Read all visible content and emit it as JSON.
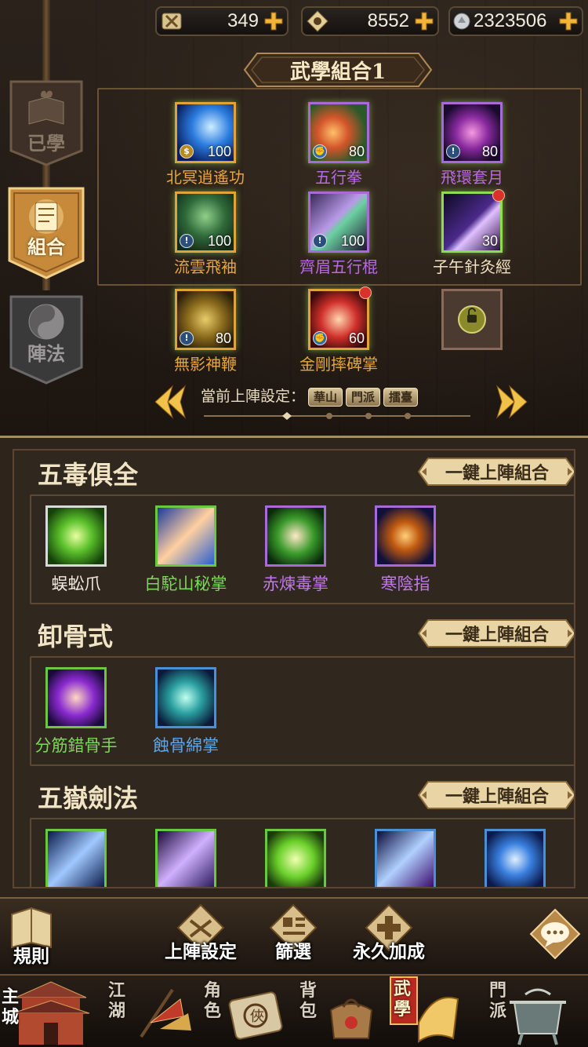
{
  "currencies": [
    {
      "icon": "tickets-icon",
      "value": "349"
    },
    {
      "icon": "jade-token-icon",
      "value": "8552"
    },
    {
      "icon": "silver-icon",
      "value": "2323506"
    }
  ],
  "combo_title": "武學組合1",
  "side_tabs": [
    {
      "label": "已學",
      "icon": "book-flame-icon"
    },
    {
      "label": "組合",
      "icon": "scroll-icon"
    },
    {
      "label": "陣法",
      "icon": "yin-yang-icon"
    }
  ],
  "top_skills": [
    {
      "name": "北冥逍遙功",
      "level": "100",
      "name_color": "#e6a63a",
      "border": "#e1a23a",
      "badge": "coin"
    },
    {
      "name": "五行拳",
      "level": "80",
      "name_color": "#b86ae0",
      "border": "#a86ad8",
      "badge": "fist"
    },
    {
      "name": "飛環套月",
      "level": "80",
      "name_color": "#b86ae0",
      "border": "#a86ad8",
      "badge": "sword"
    },
    {
      "name": "流雲飛袖",
      "level": "100",
      "name_color": "#e6a63a",
      "border": "#e1a23a",
      "badge": "sword"
    },
    {
      "name": "齊眉五行棍",
      "level": "100",
      "name_color": "#b86ae0",
      "border": "#a86ad8",
      "badge": "sword"
    },
    {
      "name": "子午針灸經",
      "level": "30",
      "name_color": "#f0e2c2",
      "border": "#8fdc50",
      "badge": "none",
      "dot": true
    },
    {
      "name": "無影神鞭",
      "level": "80",
      "name_color": "#e6a63a",
      "border": "#e1a23a",
      "badge": "sword"
    },
    {
      "name": "金剛摔碑掌",
      "level": "60",
      "name_color": "#e6a63a",
      "border": "#e1a23a",
      "badge": "fist",
      "dot": true
    }
  ],
  "pager": {
    "label": "當前上陣設定：",
    "chips": [
      "華山",
      "門派",
      "擂臺"
    ]
  },
  "groups": [
    {
      "title": "五毒俱全",
      "button": "一鍵上陣組合",
      "skills": [
        {
          "name": "蜈蚣爪",
          "color": "#f2ece0",
          "border": "#d9d9d9"
        },
        {
          "name": "白駝山秘掌",
          "color": "#7cd858",
          "border": "#6ac840"
        },
        {
          "name": "赤煉毒掌",
          "color": "#c07ae8",
          "border": "#a86ad8"
        },
        {
          "name": "寒陰指",
          "color": "#c07ae8",
          "border": "#a86ad8"
        }
      ]
    },
    {
      "title": "卸骨式",
      "button": "一鍵上陣組合",
      "skills": [
        {
          "name": "分筋錯骨手",
          "color": "#7cd858",
          "border": "#6ac840"
        },
        {
          "name": "蝕骨綿掌",
          "color": "#5aa8ee",
          "border": "#4a90d8"
        }
      ]
    },
    {
      "title": "五嶽劍法",
      "button": "一鍵上陣組合",
      "skills": [
        {
          "name": "",
          "color": "#7cd858",
          "border": "#6ac840"
        },
        {
          "name": "",
          "color": "#7cd858",
          "border": "#6ac840"
        },
        {
          "name": "",
          "color": "#7cd858",
          "border": "#6ac840"
        },
        {
          "name": "",
          "color": "#5aa8ee",
          "border": "#4a90d8"
        },
        {
          "name": "",
          "color": "#5aa8ee",
          "border": "#4a90d8"
        }
      ]
    }
  ],
  "actions": [
    {
      "label": "規則",
      "icon": "rules-book-icon"
    },
    {
      "label": "上陣設定",
      "icon": "formation-icon"
    },
    {
      "label": "篩選",
      "icon": "filter-icon"
    },
    {
      "label": "永久加成",
      "icon": "bonus-scroll-icon"
    },
    {
      "label": "",
      "icon": "chat-bubble-icon"
    }
  ],
  "bottom_nav": [
    {
      "label": "主城",
      "icon": "palace-icon"
    },
    {
      "label": "江湖",
      "icon": "flag-icon"
    },
    {
      "label": "角色",
      "icon": "hero-scroll-icon"
    },
    {
      "label": "背包",
      "icon": "bag-icon"
    },
    {
      "label": "武學",
      "icon": "martial-scroll-icon",
      "active": true
    },
    {
      "label": "門派",
      "icon": "cauldron-icon"
    }
  ]
}
